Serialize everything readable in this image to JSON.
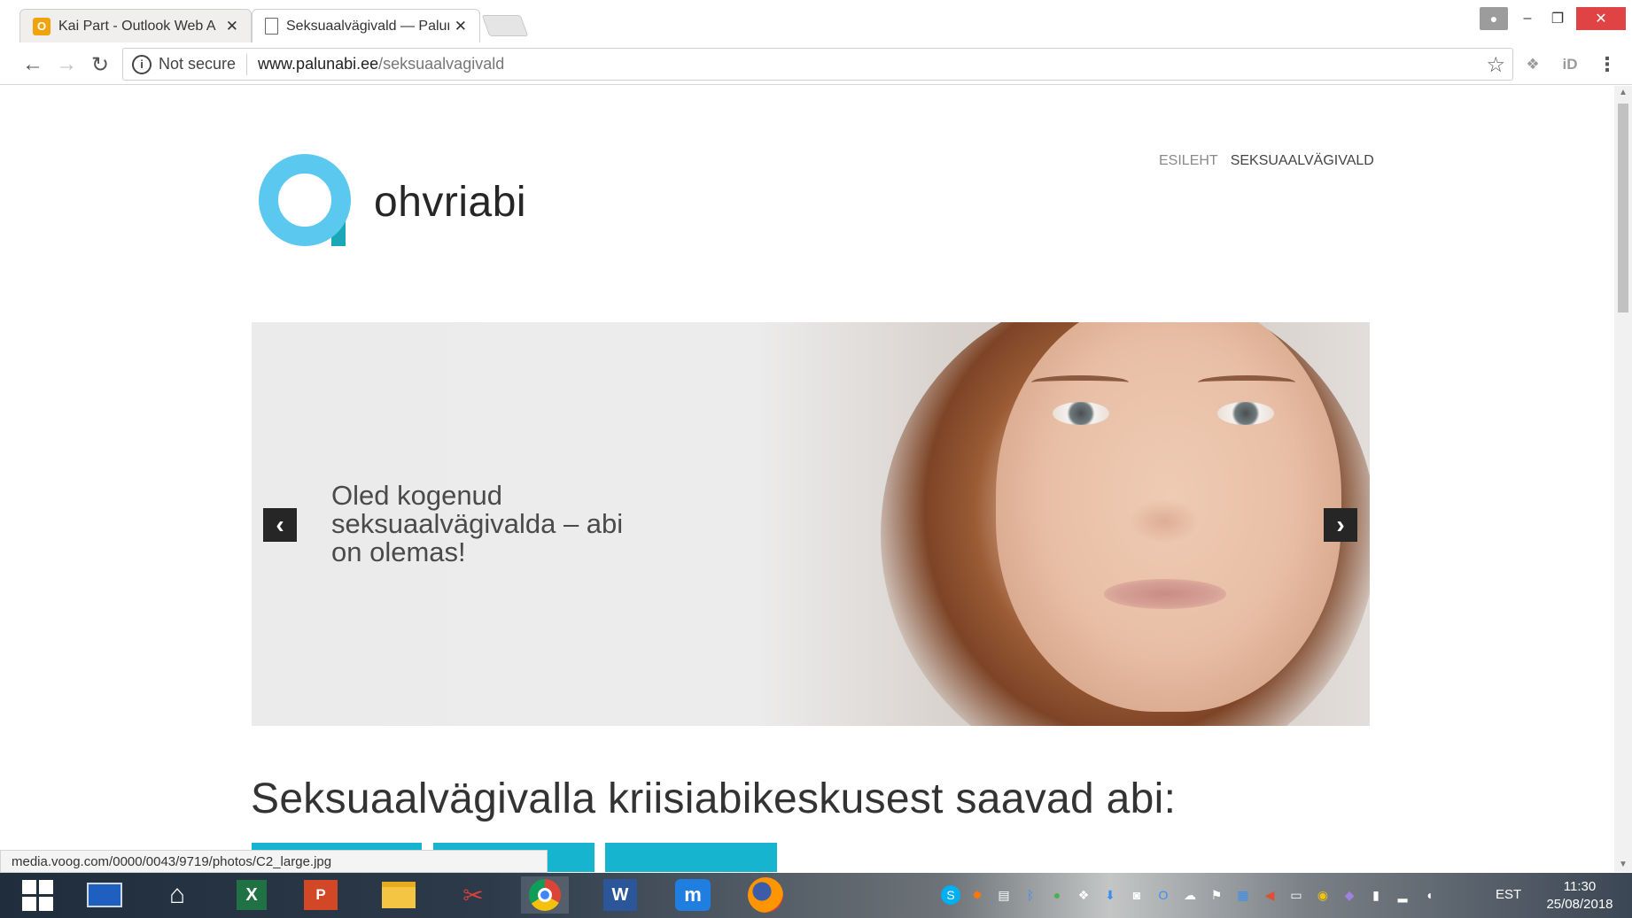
{
  "browser": {
    "tabs": [
      {
        "title": "Kai Part - Outlook Web A",
        "favicon": "outlook-icon",
        "active": false
      },
      {
        "title": "Seksuaalvägivald — Palun",
        "favicon": "document-icon",
        "active": true
      }
    ],
    "omnibox": {
      "security_label": "Not secure",
      "host": "www.palunabi.ee",
      "path": "/seksuaalvagivald"
    },
    "status_url": "media.voog.com/0000/0043/9719/photos/C2_large.jpg"
  },
  "page": {
    "logo_text": "ohvriabi",
    "nav": {
      "home": "ESILEHT",
      "current": "SEKSUAALVÄGIVALD"
    },
    "hero": {
      "text": "Oled kogenud seksuaalvägivalda – abi on olemas!"
    },
    "section_title": "Seksuaalvägivalla kriisiabikeskusest saavad abi:"
  },
  "taskbar": {
    "language": "EST",
    "time": "11:30",
    "date": "25/08/2018"
  },
  "colors": {
    "accent_cyan": "#17b4cf",
    "logo_blue": "#5bc8f0",
    "logo_teal": "#1aa7b8"
  }
}
